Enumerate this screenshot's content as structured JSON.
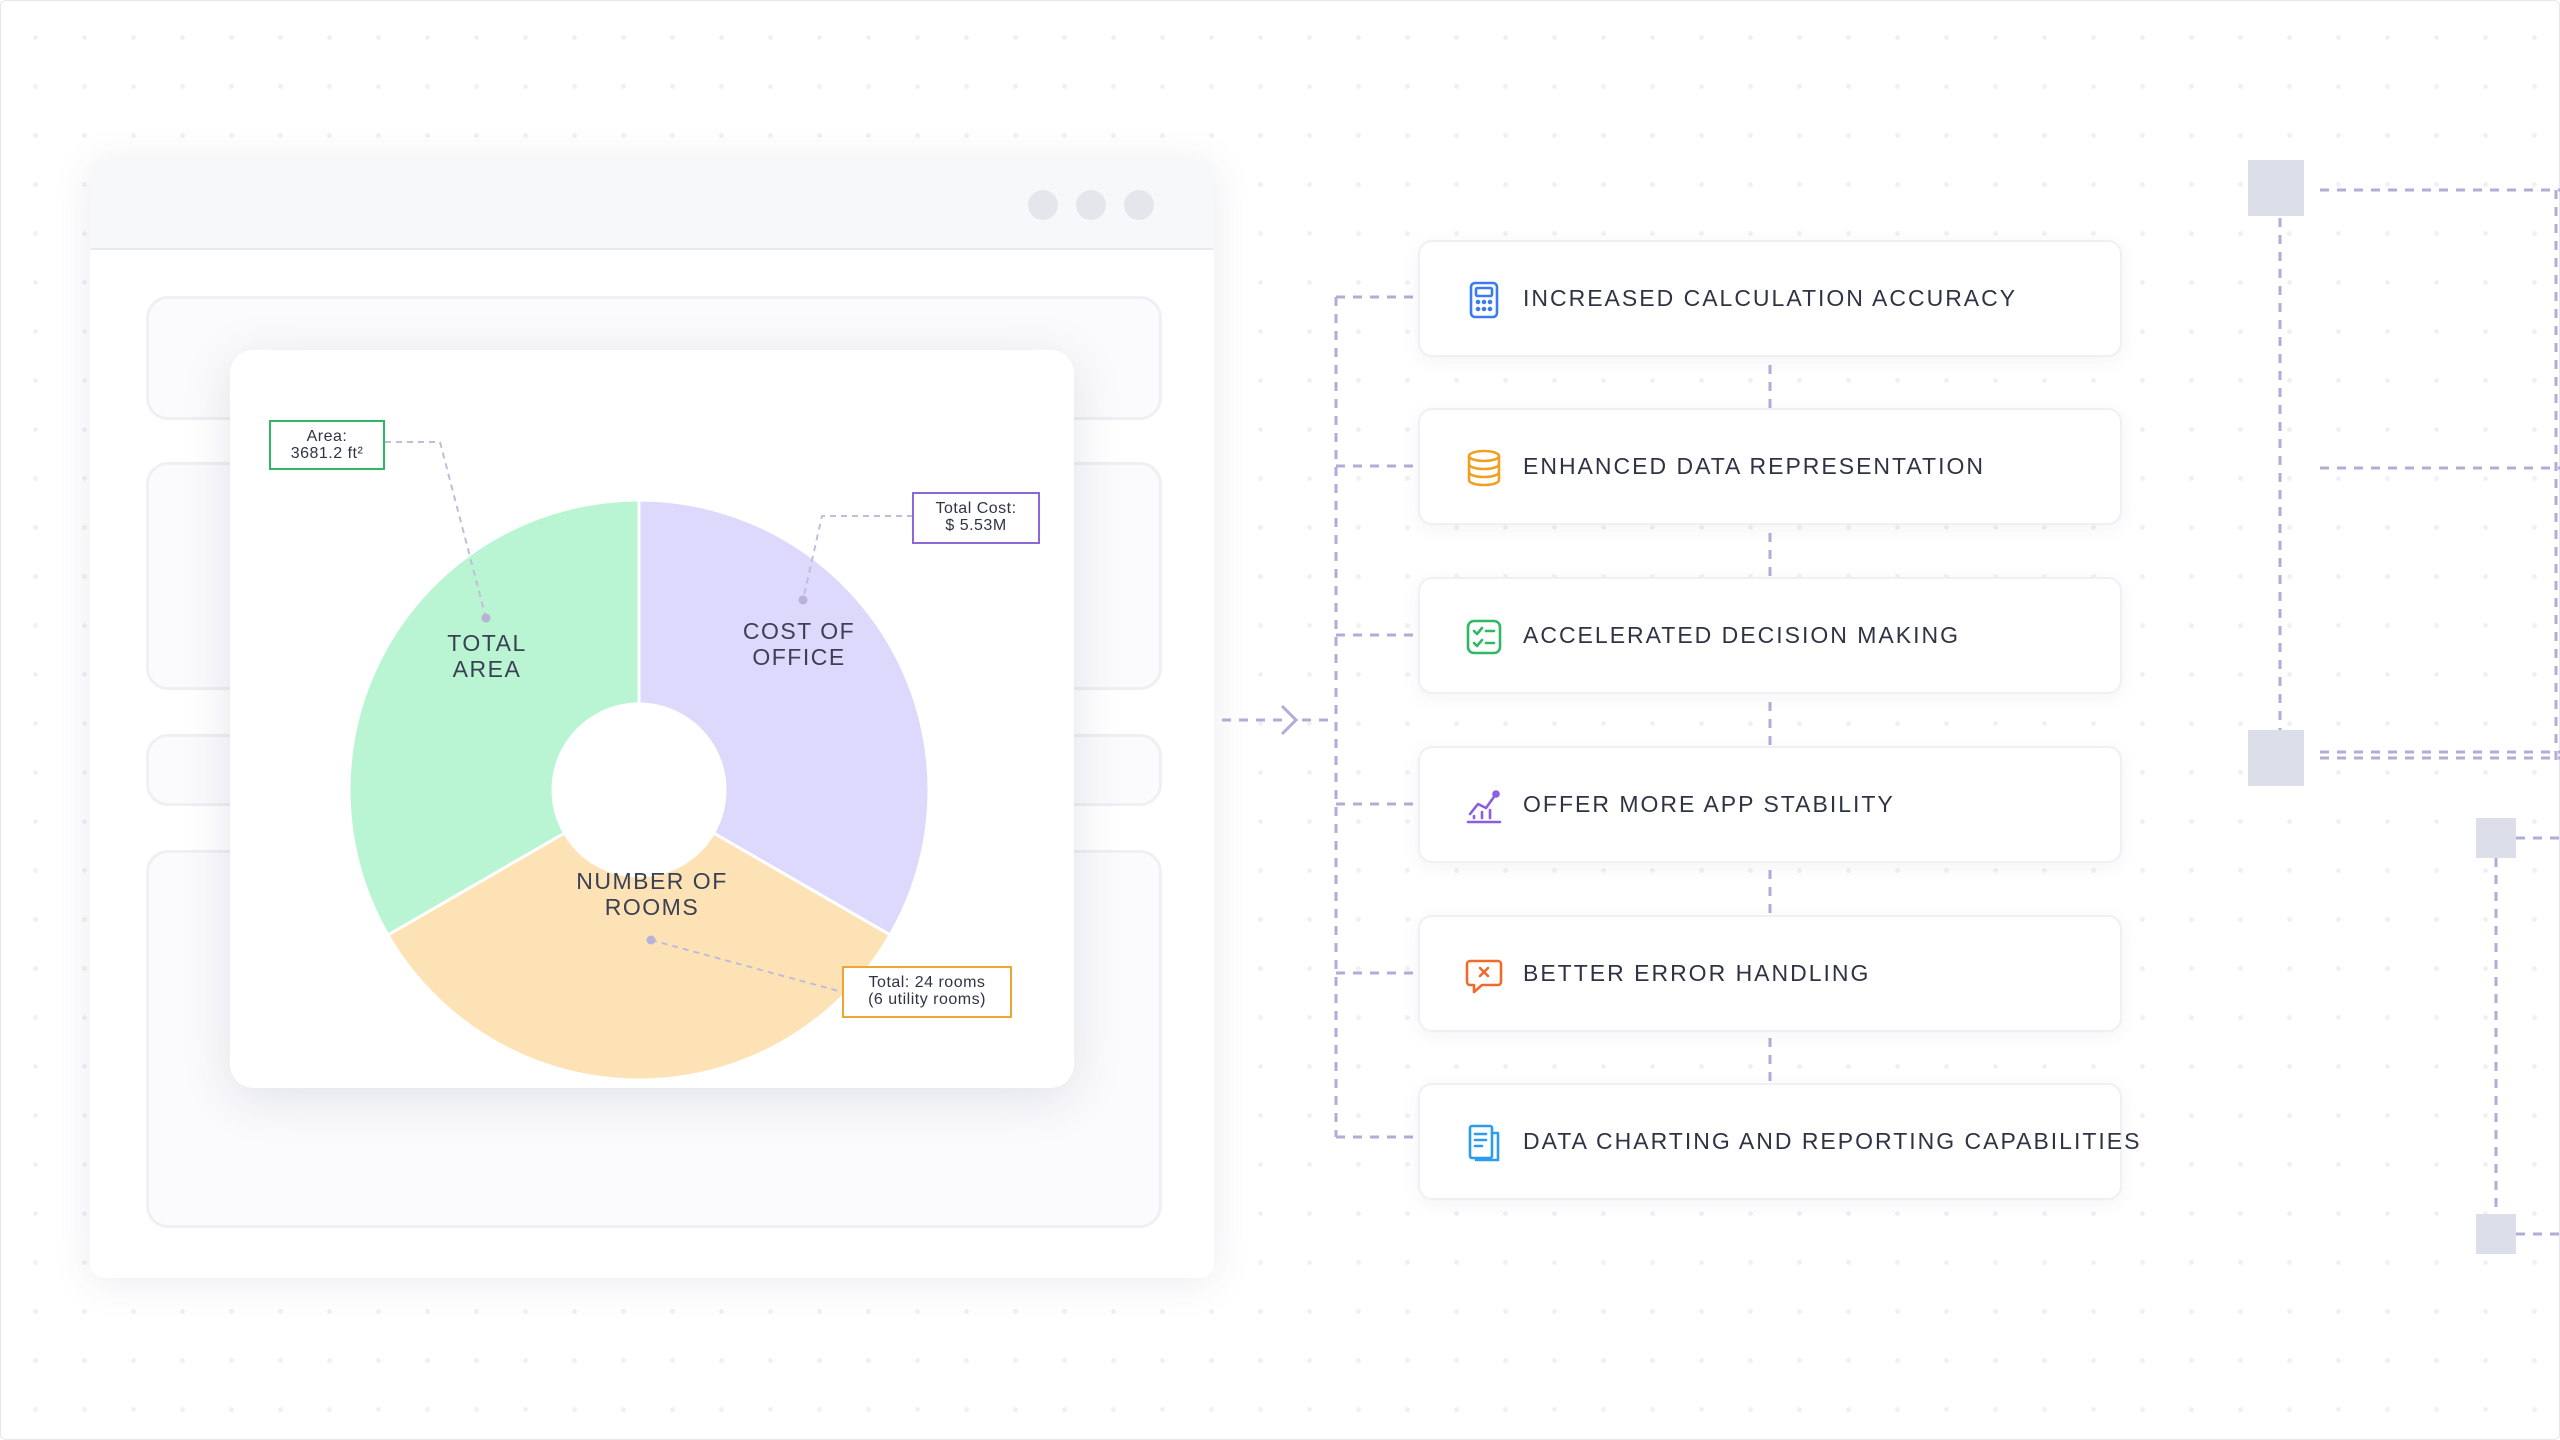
{
  "chart_data": {
    "type": "donut",
    "title": "",
    "segments": [
      {
        "label": "COST OF OFFICE",
        "share": 0.3333,
        "color": "#ddd9fd",
        "callout": {
          "lines": [
            "Total Cost:",
            "$ 5.53M"
          ],
          "border_color": "#8a68d8"
        }
      },
      {
        "label": "NUMBER OF ROOMS",
        "share": 0.3333,
        "color": "#fde2b5",
        "callout": {
          "lines": [
            "Total: 24 rooms",
            "(6 utility rooms)"
          ],
          "border_color": "#f0a532"
        }
      },
      {
        "label": "TOTAL AREA",
        "share": 0.3333,
        "color": "#baf5d3",
        "callout": {
          "lines": [
            "Area:",
            "3681.2 ft²"
          ],
          "border_color": "#2fb862"
        }
      }
    ]
  },
  "labels": {
    "cost_line1": "COST OF",
    "cost_line2": "OFFICE",
    "rooms_line1": "NUMBER OF",
    "rooms_line2": "ROOMS",
    "area_line1": "TOTAL",
    "area_line2": "AREA",
    "area_callout_1": "Area:",
    "area_callout_2": "3681.2 ft²",
    "cost_callout_1": "Total Cost:",
    "cost_callout_2": "$ 5.53M",
    "rooms_callout_1": "Total: 24 rooms",
    "rooms_callout_2": "(6 utility rooms)"
  },
  "benefits": [
    {
      "label": "INCREASED CALCULATION ACCURACY",
      "icon": "calculator-icon",
      "color": "#3a7bf0"
    },
    {
      "label": "ENHANCED DATA REPRESENTATION",
      "icon": "database-icon",
      "color": "#f0a020"
    },
    {
      "label": "ACCELERATED DECISION MAKING",
      "icon": "checklist-icon",
      "color": "#2fb862"
    },
    {
      "label": "OFFER MORE APP STABILITY",
      "icon": "growth-chart-icon",
      "color": "#8a5ee0"
    },
    {
      "label": "BETTER ERROR HANDLING",
      "icon": "error-message-icon",
      "color": "#f06a2c"
    },
    {
      "label": "DATA CHARTING AND REPORTING CAPABILITIES",
      "icon": "report-document-icon",
      "color": "#2a9df0"
    }
  ],
  "colors": {
    "connector": "#b3acd8",
    "deco_square": "#dcdeea"
  }
}
